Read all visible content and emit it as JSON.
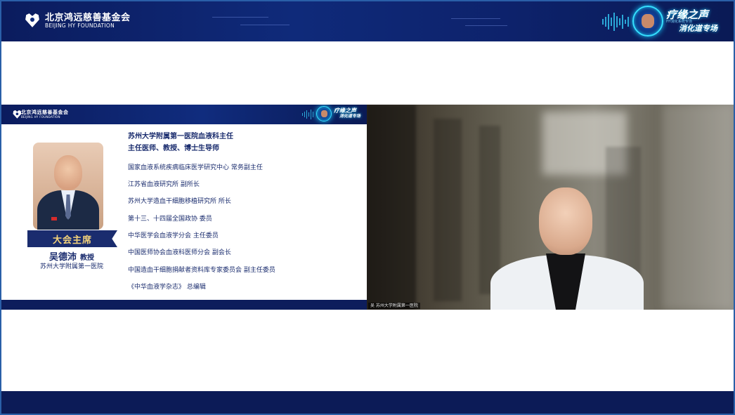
{
  "window": {
    "foundation_name_cn": "北京鸿远慈善基金会",
    "foundation_name_en": "BEIJING HY FOUNDATION",
    "program_title": "疗缘之声",
    "program_subtitle": "HY消化系统专场",
    "program_track": "消化道专场"
  },
  "slide": {
    "foundation_name_cn": "北京鸿远慈善基金会",
    "foundation_name_en": "BEIJING HY FOUNDATION",
    "program_title": "疗缘之声",
    "program_track": "消化道专场",
    "role": "大会主席",
    "person_name": "吴德沛",
    "person_title": "教授",
    "person_org": "苏州大学附属第一医院",
    "headline": [
      "苏州大学附属第一医院血液科主任",
      "主任医师、教授、博士生导师"
    ],
    "duties": [
      "国家血液系统疾病临床医学研究中心 常务副主任",
      "江苏省血液研究所 副所长",
      "苏州大学造血干细胞移植研究所 所长",
      "第十三、十四届全国政协 委员",
      "中华医学会血液学分会 主任委员",
      "中国医师协会血液科医师分会 副会长",
      "中国造血干细胞捐献者资料库专家委员会 副主任委员",
      "《中华血液学杂志》 总编辑"
    ]
  },
  "video": {
    "participant_label": "吴 苏州大学附属第一医院"
  },
  "colors": {
    "navy": "#0c1b57",
    "accent_cyan": "#36d6ff",
    "gold": "#f4d27a",
    "text_navy": "#1a2c6e"
  }
}
